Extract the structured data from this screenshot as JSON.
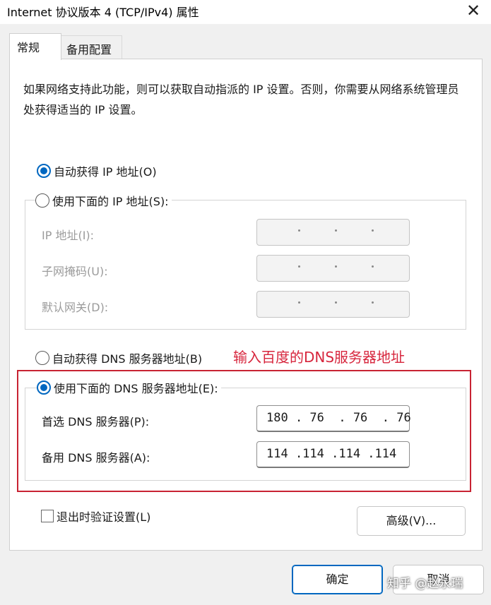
{
  "window": {
    "title": "Internet 协议版本 4 (TCP/IPv4) 属性",
    "close_glyph": "✕"
  },
  "tabs": [
    {
      "label": "常规",
      "selected": true
    },
    {
      "label": "备用配置",
      "selected": false
    }
  ],
  "description": "如果网络支持此功能，则可以获取自动指派的 IP 设置。否则，你需要从网络系统管理员处获得适当的 IP 设置。",
  "ip_section": {
    "auto_label": "自动获得 IP 地址(O)",
    "manual_label": "使用下面的 IP 地址(S):",
    "auto_selected": true,
    "fields": [
      {
        "label": "IP 地址(I):",
        "value": ""
      },
      {
        "label": "子网掩码(U):",
        "value": ""
      },
      {
        "label": "默认网关(D):",
        "value": ""
      }
    ]
  },
  "dns_section": {
    "auto_label": "自动获得 DNS 服务器地址(B)",
    "manual_label": "使用下面的 DNS 服务器地址(E):",
    "manual_selected": true,
    "preferred_label": "首选 DNS 服务器(P):",
    "preferred_value": "180 . 76  . 76  . 76",
    "alternate_label": "备用 DNS 服务器(A):",
    "alternate_value": "114 .114 .114 .114"
  },
  "annotation": {
    "text": "输入百度的DNS服务器地址",
    "color": "#d7263d"
  },
  "validate": {
    "label": "退出时验证设置(L)",
    "checked": false
  },
  "buttons": {
    "advanced": "高级(V)...",
    "ok": "确定",
    "cancel": "取消"
  },
  "watermark": "知乎 @赵永瑞",
  "colors": {
    "accent": "#0067c0",
    "highlight_border": "#c82333"
  }
}
